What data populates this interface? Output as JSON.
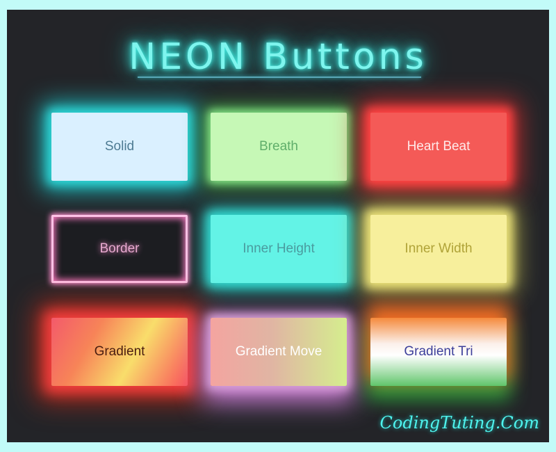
{
  "title": "NEON Buttons",
  "buttons": [
    {
      "label": "Solid"
    },
    {
      "label": "Breath"
    },
    {
      "label": "Heart Beat"
    },
    {
      "label": "Border"
    },
    {
      "label": "Inner Height"
    },
    {
      "label": "Inner Width"
    },
    {
      "label": "Gradient"
    },
    {
      "label": "Gradient Move"
    },
    {
      "label": "Gradient Tri"
    }
  ],
  "watermark": "CodingTuting.Com",
  "colors": {
    "background": "#232428",
    "accent": "#45f3e8",
    "page_border": "#c2fbf8"
  }
}
